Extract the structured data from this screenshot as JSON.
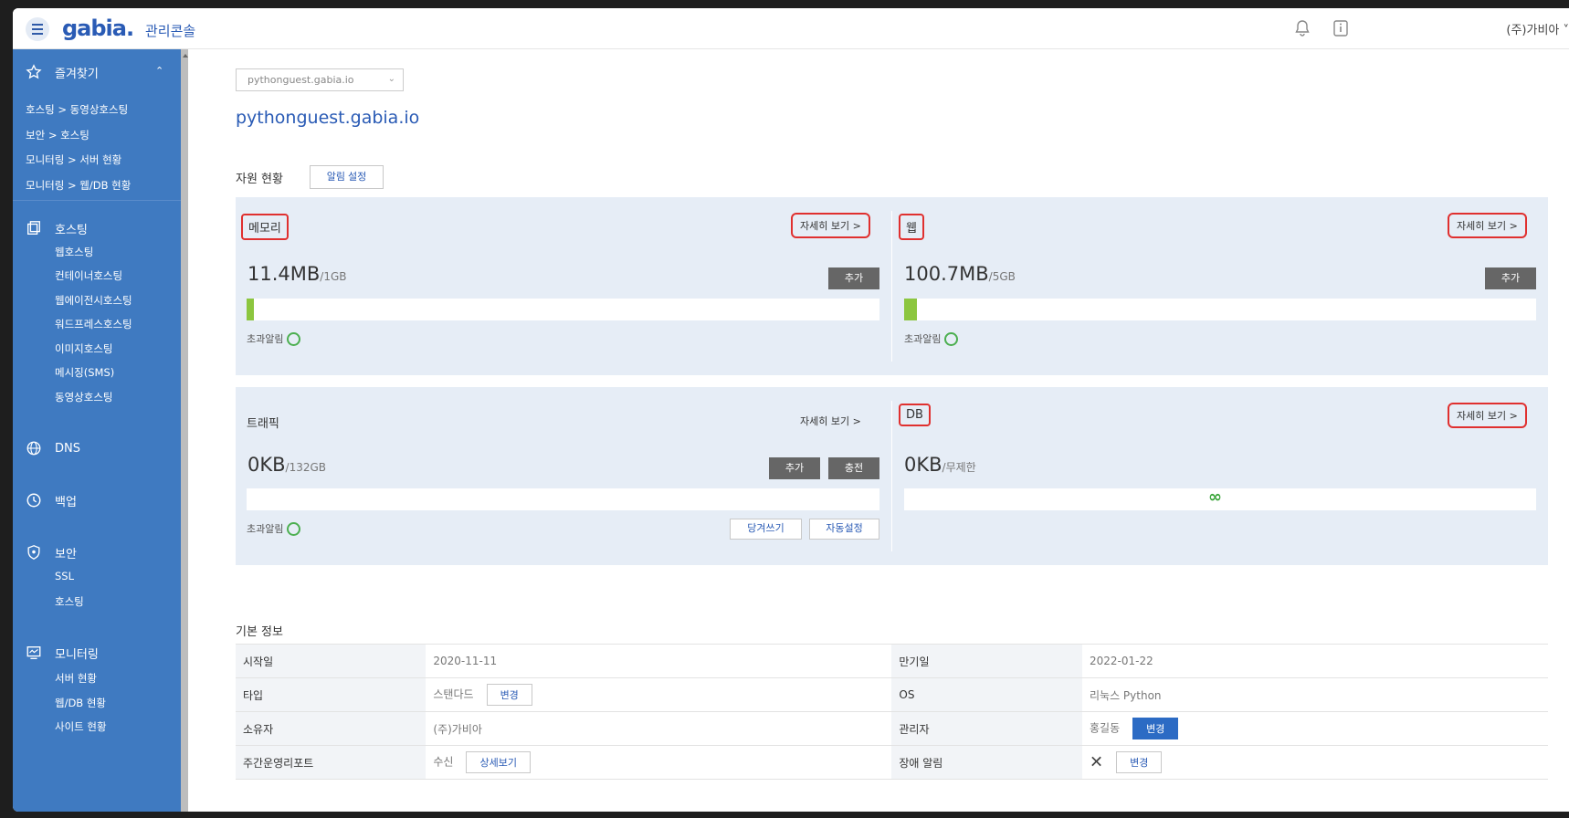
{
  "header": {
    "logo": "gabia.",
    "console_title": "관리콘솔",
    "user": "(주)가비아 ˅",
    "icons": [
      "bell-icon",
      "info-icon"
    ]
  },
  "sidebar": {
    "favorites": {
      "title": "즐겨찾기",
      "links": [
        "호스팅 > 동영상호스팅",
        "보안 > 호스팅",
        "모니터링 > 서버 현황",
        "모니터링 > 웹/DB 현황"
      ]
    },
    "hosting": {
      "title": "호스팅",
      "links": [
        "웹호스팅",
        "컨테이너호스팅",
        "웹에이전시호스팅",
        "워드프레스호스팅",
        "이미지호스팅",
        "메시징(SMS)",
        "동영상호스팅"
      ]
    },
    "dns": {
      "title": "DNS"
    },
    "backup": {
      "title": "백업"
    },
    "security": {
      "title": "보안",
      "links": [
        "SSL",
        "호스팅"
      ]
    },
    "monitoring": {
      "title": "모니터링",
      "links": [
        "서버 현황",
        "웹/DB 현황",
        "사이트 현황"
      ]
    }
  },
  "main": {
    "domain_select": "pythonguest.gabia.io",
    "domain_title": "pythonguest.gabia.io",
    "resource_label": "자원 현황",
    "alert_settings": "알림 설정",
    "cards": {
      "memory": {
        "title": "메모리",
        "detail": "자세히 보기 >",
        "used": "11.4MB",
        "total": "/1GB",
        "add": "추가",
        "alert": "초과알림",
        "fill_pct": 1.1
      },
      "web": {
        "title": "웹",
        "detail": "자세히 보기 >",
        "used": "100.7MB",
        "total": "/5GB",
        "add": "추가",
        "alert": "초과알림",
        "fill_pct": 2
      },
      "traffic": {
        "title": "트래픽",
        "detail": "자세히 보기 >",
        "used": "0KB",
        "total": "/132GB",
        "add": "추가",
        "charge": "충전",
        "alert": "초과알림",
        "pull": "당겨쓰기",
        "auto": "자동설정",
        "fill_pct": 0
      },
      "db": {
        "title": "DB",
        "detail": "자세히 보기 >",
        "used": "0KB",
        "total": "/무제한",
        "unlimited_icon": "∞"
      }
    },
    "basic_info": {
      "label": "기본 정보",
      "start_label": "시작일",
      "start": "2020-11-11",
      "expire_label": "만기일",
      "expire": "2022-01-22",
      "type_label": "타입",
      "type": "스탠다드",
      "type_btn": "변경",
      "os_label": "OS",
      "os": "리눅스 Python",
      "owner_label": "소유자",
      "owner": "(주)가비아",
      "admin_label": "관리자",
      "admin": "홍길동",
      "admin_btn": "변경",
      "report_label": "주간운영리포트",
      "report": "수신",
      "report_btn": "상세보기",
      "fault_label": "장애 알림",
      "fault": "✕",
      "fault_btn": "변경"
    }
  }
}
